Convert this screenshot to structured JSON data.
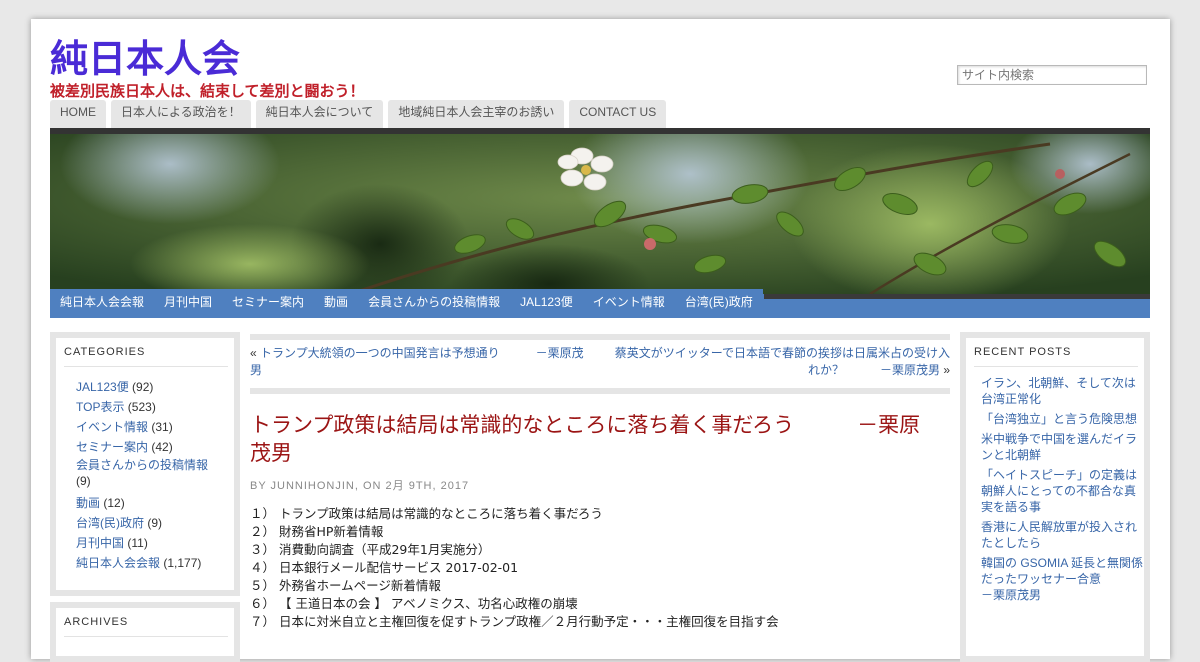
{
  "site": {
    "title": "純日本人会",
    "tagline": "被差別民族日本人は、結束して差別と闘おう！"
  },
  "search": {
    "placeholder": "サイト内検索"
  },
  "top_nav": [
    "HOME",
    "日本人による政治を！",
    "純日本人会について",
    "地域純日本人会主宰のお誘い",
    "CONTACT US"
  ],
  "sub_nav": [
    "純日本人会会報",
    "月刊中国",
    "セミナー案内",
    "動画",
    "会員さんからの投稿情報",
    "JAL123便",
    "イベント情報",
    "台湾(民)政府"
  ],
  "categories": {
    "title": "CATEGORIES",
    "items": [
      {
        "name": "JAL123便",
        "count": "(92)"
      },
      {
        "name": "TOP表示",
        "count": "(523)"
      },
      {
        "name": "イベント情報",
        "count": "(31)"
      },
      {
        "name": "セミナー案内",
        "count": "(42)"
      },
      {
        "name": "会員さんからの投稿情報",
        "count": "(9)"
      },
      {
        "name": "動画",
        "count": "(12)"
      },
      {
        "name": "台湾(民)政府",
        "count": "(9)"
      },
      {
        "name": "月刊中国",
        "count": "(11)"
      },
      {
        "name": "純日本人会会報",
        "count": "(1,177)"
      }
    ]
  },
  "archives": {
    "title": "ARCHIVES"
  },
  "post_nav": {
    "prev_arrow": "«",
    "prev": "トランプ大統領の一つの中国発言は予想通り　　　－栗原茂男",
    "next": "蔡英文がツイッ­ターで日本語で春節の挨拶は日属米占の受け入れか？　　　－栗原茂男",
    "next_arrow": "»"
  },
  "post": {
    "title": "トランプ政策は結局は常識的なところに落ち着く事だろう　　　－栗原茂男",
    "byline": "BY JUNNIHONJIN, ON 2月 9TH, 2017",
    "items": [
      "１）  トランプ政策は結局は常識的なところに落ち着く事だろう",
      "２）  財務省HP新着情報",
      "３）  消費動向調査（平成29年1月実施分）",
      "４）  日本銀行メール配信サービス 2017-02-01",
      "５）  外務省ホームページ新着情報",
      "６）   【 王道日本の会 】 アベノミクス、功名心政権の崩壊",
      "７）  日本に対米自立と主権回復を促すトランプ政権／２月行動予定・・・主権回復を目指す会"
    ]
  },
  "recent_posts": {
    "title": "RECENT POSTS",
    "items": [
      "イラン、北朝鮮、そして次は台湾正常化",
      "「台湾独立」と言う危険思想",
      "米中戦争で中国を選んだイランと北朝鮮",
      "「ヘイトスピーチ」の定義は朝鮮人にとっての不都合な真実を語る事",
      "香港に人民解放軍が投入されたとしたら",
      "韓国の GSOMIA 延長と無関係だったワッセナー合意　　　－栗原茂男"
    ]
  },
  "colors": {
    "site_title": "#4a2bd6",
    "tagline": "#c0202a",
    "post_title": "#9b1414",
    "link": "#3866a8",
    "subnav": "#4f80c0"
  }
}
